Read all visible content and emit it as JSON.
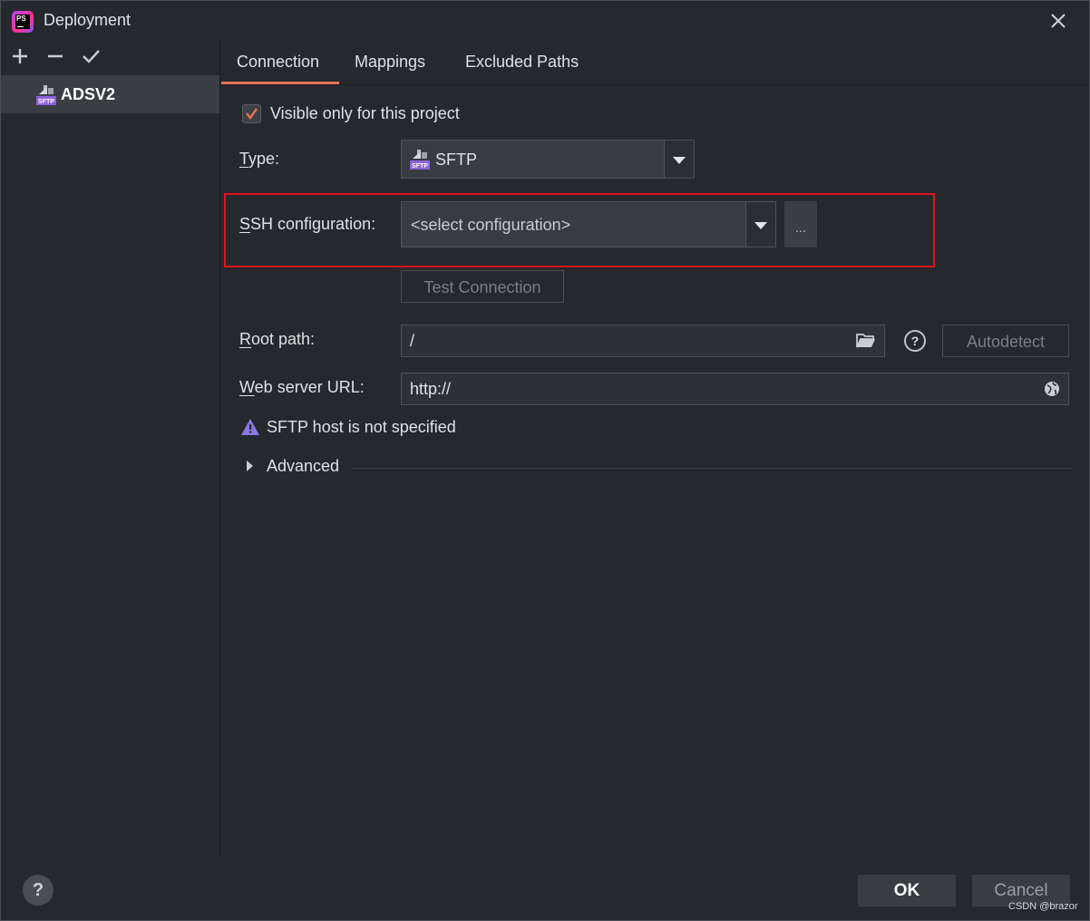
{
  "window": {
    "title": "Deployment"
  },
  "sidebar": {
    "toolbar": {
      "add_icon": "plus-icon",
      "remove_icon": "minus-icon",
      "apply_icon": "check-icon"
    },
    "items": [
      {
        "label": "ADSV2",
        "icon": "sftp-icon",
        "selected": true
      }
    ]
  },
  "tabs": [
    {
      "label": "Connection",
      "active": true
    },
    {
      "label": "Mappings",
      "active": false
    },
    {
      "label": "Excluded Paths",
      "active": false
    }
  ],
  "connection": {
    "visible_only_label": "Visible only for this project",
    "visible_only_checked": true,
    "type_label": "Type:",
    "type_value": "SFTP",
    "ssh_label": "SSH configuration:",
    "ssh_placeholder": "<select configuration>",
    "ssh_more_label": "...",
    "test_connection_label": "Test Connection",
    "root_path_label": "Root path:",
    "root_path_value": "/",
    "autodetect_label": "Autodetect",
    "help_glyph": "?",
    "web_url_label": "Web server URL:",
    "web_url_value": "http://",
    "warning_text": "SFTP host is not specified",
    "advanced_label": "Advanced"
  },
  "footer": {
    "help_glyph": "?",
    "ok_label": "OK",
    "cancel_label": "Cancel"
  },
  "watermark": "CSDN @brazor",
  "colors": {
    "accent": "#e4745b",
    "highlight_box": "#e3131b",
    "background": "#25282d"
  }
}
